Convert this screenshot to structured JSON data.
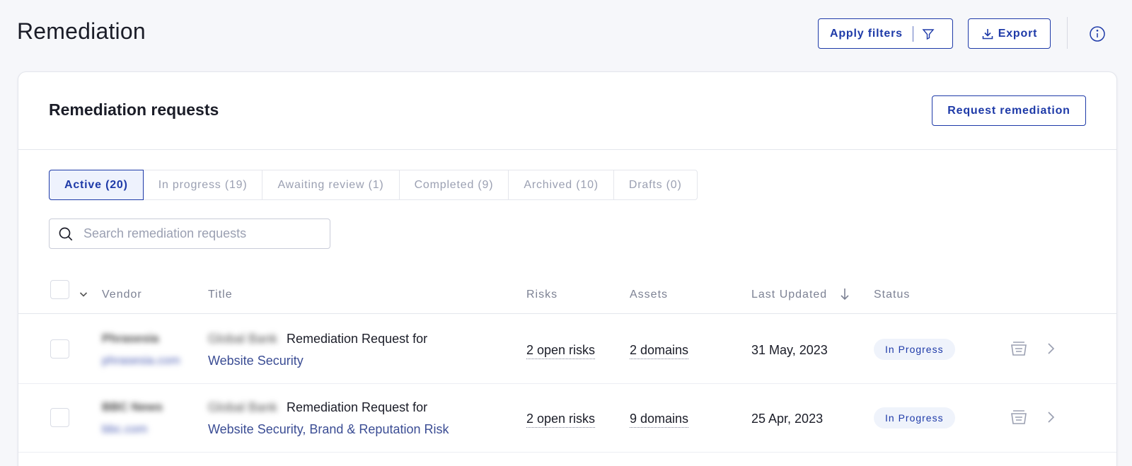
{
  "page": {
    "title": "Remediation"
  },
  "toolbar": {
    "apply_filters_label": "Apply filters",
    "export_label": "Export"
  },
  "card": {
    "title": "Remediation requests",
    "request_button_label": "Request remediation"
  },
  "tabs": [
    {
      "label": "Active (20)",
      "active": true
    },
    {
      "label": "In progress (19)"
    },
    {
      "label": "Awaiting review (1)"
    },
    {
      "label": "Completed (9)"
    },
    {
      "label": "Archived (10)"
    },
    {
      "label": "Drafts (0)"
    }
  ],
  "search": {
    "placeholder": "Search remediation requests"
  },
  "table": {
    "headers": {
      "vendor": "Vendor",
      "title": "Title",
      "risks": "Risks",
      "assets": "Assets",
      "last_updated": "Last Updated",
      "status": "Status"
    },
    "rows": [
      {
        "vendor_name": "Phrasesia",
        "vendor_domain": "phrasesia.com",
        "title_owner": "Global Bank",
        "title_main": "Remediation Request for",
        "title_sub": "Website Security",
        "risks": "2 open risks",
        "assets": "2 domains",
        "last_updated": "31 May, 2023",
        "status": "In Progress"
      },
      {
        "vendor_name": "BBC News",
        "vendor_domain": "bbc.com",
        "title_owner": "Global Bank",
        "title_main": "Remediation Request for",
        "title_sub": "Website Security, Brand & Reputation Risk",
        "risks": "2 open risks",
        "assets": "9 domains",
        "last_updated": "25 Apr, 2023",
        "status": "In Progress"
      }
    ]
  },
  "colors": {
    "accent": "#1e3aa8",
    "badge_bg": "#eff3fb",
    "page_bg": "#f6f7fa"
  }
}
